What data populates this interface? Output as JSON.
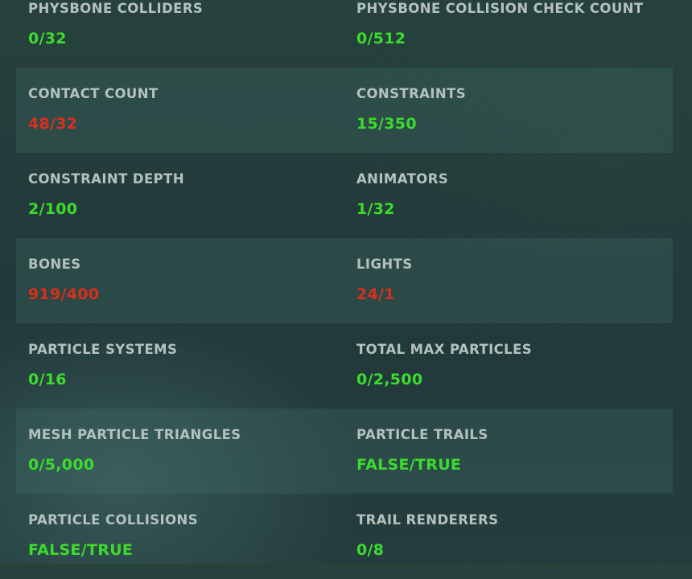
{
  "colors": {
    "label": "#b4c2be",
    "ok": "#3cdc2c",
    "bad": "#d8301c"
  },
  "stats": [
    {
      "label": "PHYSBONE COLLIDERS",
      "value": "0/32",
      "status": "ok"
    },
    {
      "label": "PHYSBONE COLLISION CHECK COUNT",
      "value": "0/512",
      "status": "ok"
    },
    {
      "label": "CONTACT COUNT",
      "value": "48/32",
      "status": "bad"
    },
    {
      "label": "CONSTRAINTS",
      "value": "15/350",
      "status": "ok"
    },
    {
      "label": "CONSTRAINT DEPTH",
      "value": "2/100",
      "status": "ok"
    },
    {
      "label": "ANIMATORS",
      "value": "1/32",
      "status": "ok"
    },
    {
      "label": "BONES",
      "value": "919/400",
      "status": "bad"
    },
    {
      "label": "LIGHTS",
      "value": "24/1",
      "status": "bad"
    },
    {
      "label": "PARTICLE SYSTEMS",
      "value": "0/16",
      "status": "ok"
    },
    {
      "label": "TOTAL MAX PARTICLES",
      "value": "0/2,500",
      "status": "ok"
    },
    {
      "label": "MESH PARTICLE TRIANGLES",
      "value": "0/5,000",
      "status": "ok"
    },
    {
      "label": "PARTICLE TRAILS",
      "value": "FALSE/TRUE",
      "status": "ok"
    },
    {
      "label": "PARTICLE COLLISIONS",
      "value": "FALSE/TRUE",
      "status": "ok"
    },
    {
      "label": "TRAIL RENDERERS",
      "value": "0/8",
      "status": "ok"
    }
  ]
}
